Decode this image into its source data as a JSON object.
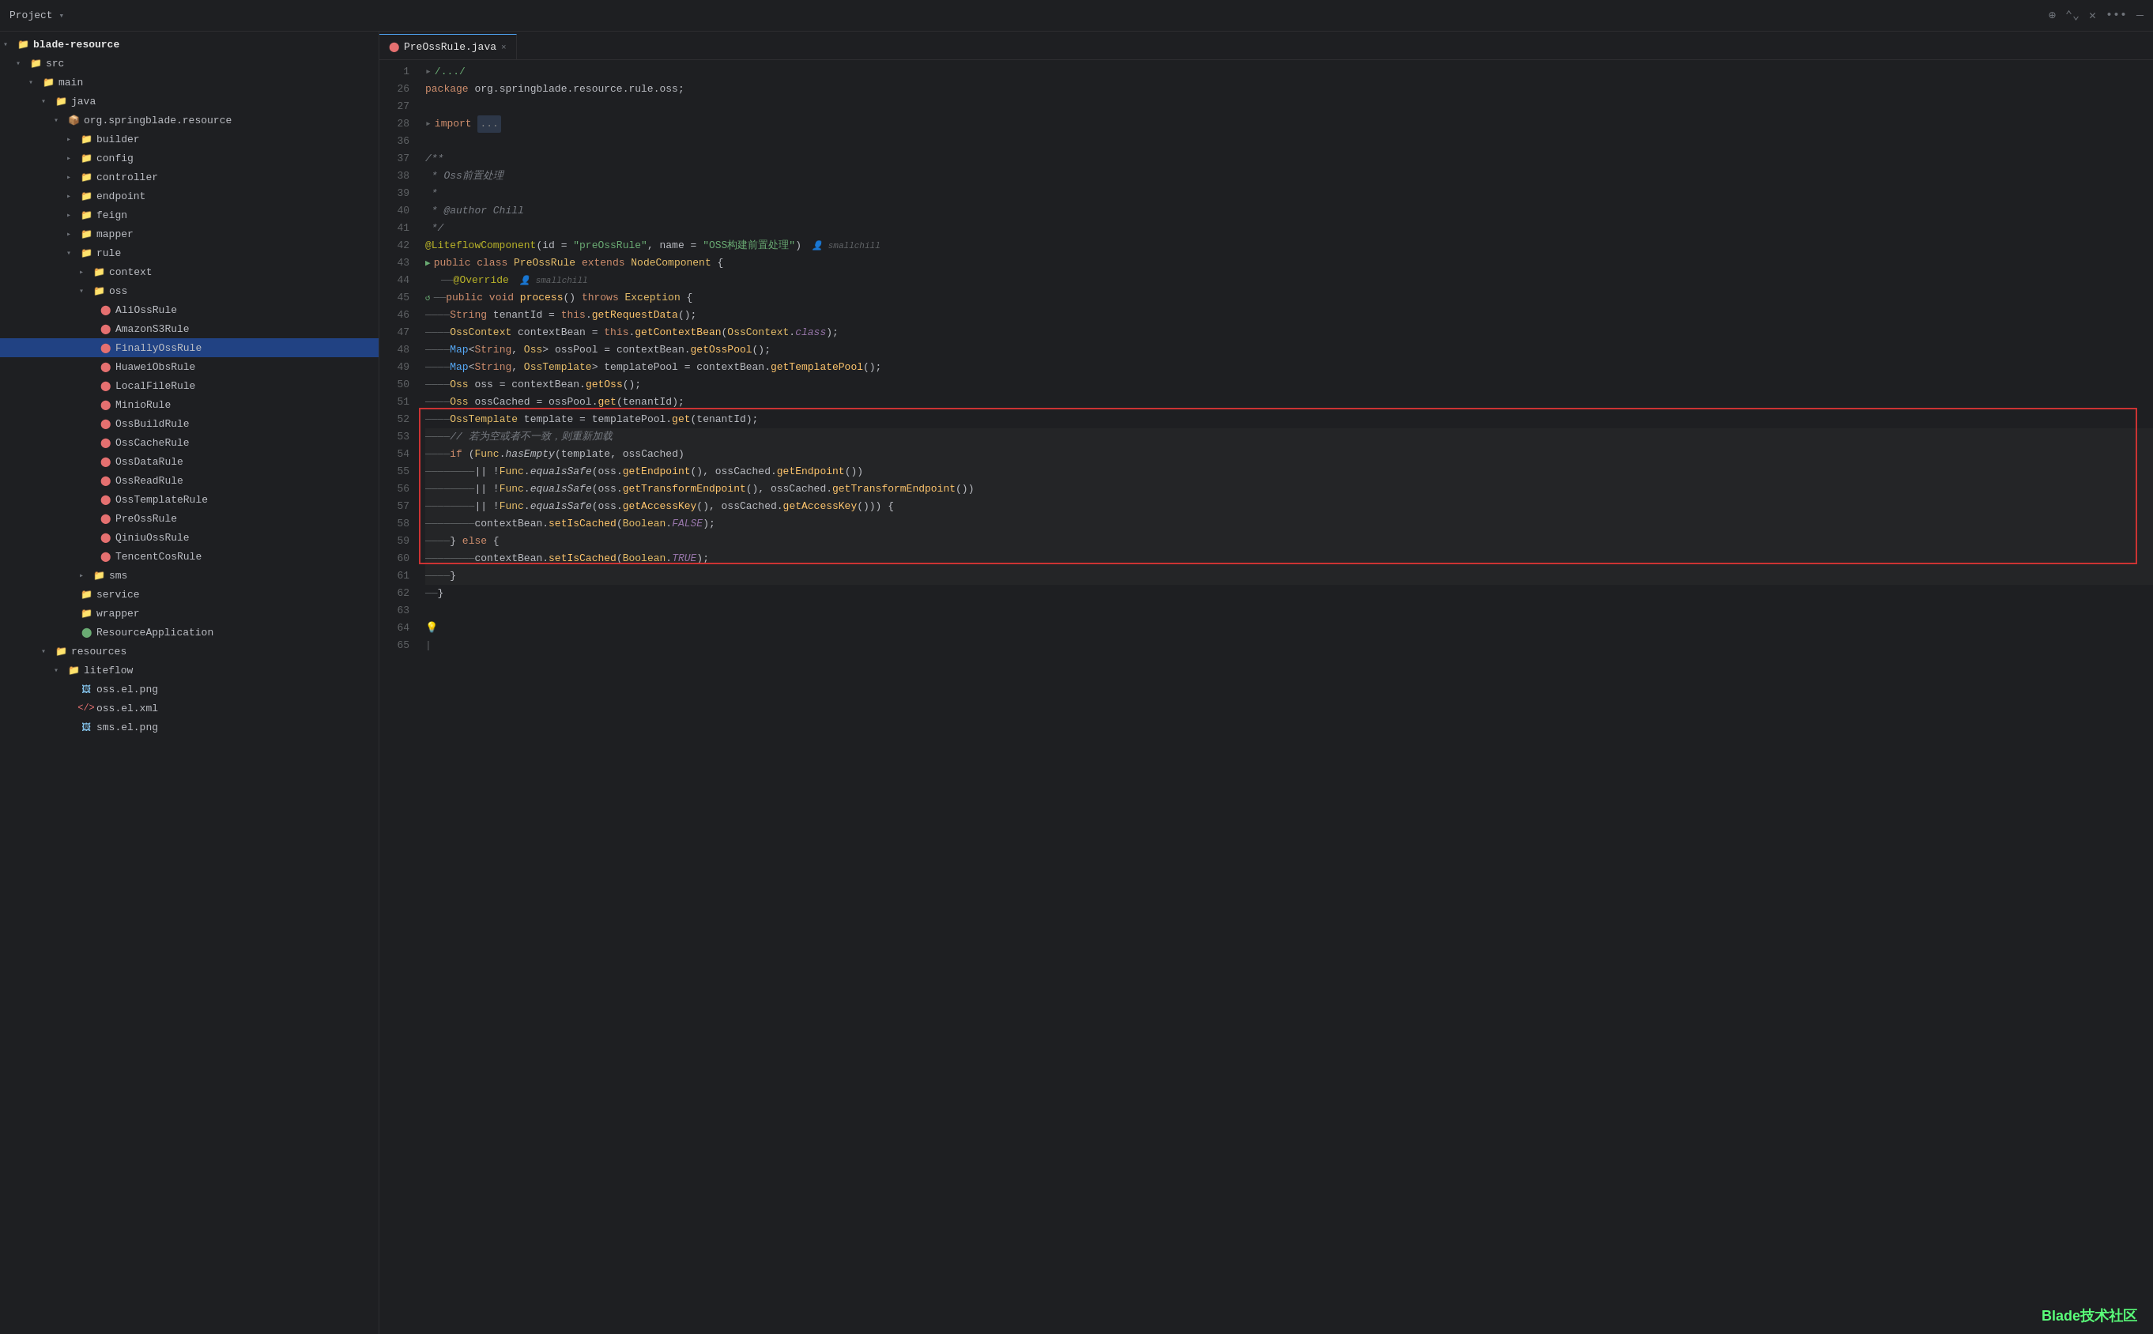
{
  "titleBar": {
    "projectLabel": "Project",
    "icons": [
      "⊕",
      "∧∨",
      "×",
      "•••",
      "—"
    ]
  },
  "tabBar": {
    "tab": {
      "icon": "●",
      "label": "PreOssRule.java",
      "close": "×"
    }
  },
  "sidebar": {
    "items": [
      {
        "id": "blade-resource",
        "label": "blade-resource",
        "indent": 0,
        "arrow": "▾",
        "type": "folder",
        "bold": true
      },
      {
        "id": "src",
        "label": "src",
        "indent": 1,
        "arrow": "▾",
        "type": "folder"
      },
      {
        "id": "main",
        "label": "main",
        "indent": 2,
        "arrow": "▾",
        "type": "folder"
      },
      {
        "id": "java",
        "label": "java",
        "indent": 3,
        "arrow": "▾",
        "type": "folder"
      },
      {
        "id": "org-springblade-resource",
        "label": "org.springblade.resource",
        "indent": 4,
        "arrow": "▾",
        "type": "package"
      },
      {
        "id": "builder",
        "label": "builder",
        "indent": 5,
        "arrow": "▸",
        "type": "folder"
      },
      {
        "id": "config",
        "label": "config",
        "indent": 5,
        "arrow": "▸",
        "type": "folder"
      },
      {
        "id": "controller",
        "label": "controller",
        "indent": 5,
        "arrow": "▸",
        "type": "folder"
      },
      {
        "id": "endpoint",
        "label": "endpoint",
        "indent": 5,
        "arrow": "▸",
        "type": "folder"
      },
      {
        "id": "feign",
        "label": "feign",
        "indent": 5,
        "arrow": "▸",
        "type": "folder"
      },
      {
        "id": "mapper",
        "label": "mapper",
        "indent": 5,
        "arrow": "▸",
        "type": "folder"
      },
      {
        "id": "rule",
        "label": "rule",
        "indent": 5,
        "arrow": "▾",
        "type": "folder"
      },
      {
        "id": "context",
        "label": "context",
        "indent": 6,
        "arrow": "▸",
        "type": "folder"
      },
      {
        "id": "oss",
        "label": "oss",
        "indent": 6,
        "arrow": "▾",
        "type": "folder"
      },
      {
        "id": "AliOssRule",
        "label": "AliOssRule",
        "indent": 7,
        "arrow": "",
        "type": "java"
      },
      {
        "id": "AmazonS3Rule",
        "label": "AmazonS3Rule",
        "indent": 7,
        "arrow": "",
        "type": "java"
      },
      {
        "id": "FinallyOssRule",
        "label": "FinallyOssRule",
        "indent": 7,
        "arrow": "",
        "type": "java",
        "selected": true
      },
      {
        "id": "HuaweiObsRule",
        "label": "HuaweiObsRule",
        "indent": 7,
        "arrow": "",
        "type": "java"
      },
      {
        "id": "LocalFileRule",
        "label": "LocalFileRule",
        "indent": 7,
        "arrow": "",
        "type": "java"
      },
      {
        "id": "MinioRule",
        "label": "MinioRule",
        "indent": 7,
        "arrow": "",
        "type": "java"
      },
      {
        "id": "OssBuildRule",
        "label": "OssBuildRule",
        "indent": 7,
        "arrow": "",
        "type": "java"
      },
      {
        "id": "OssCacheRule",
        "label": "OssCacheRule",
        "indent": 7,
        "arrow": "",
        "type": "java"
      },
      {
        "id": "OssDataRule",
        "label": "OssDataRule",
        "indent": 7,
        "arrow": "",
        "type": "java"
      },
      {
        "id": "OssReadRule",
        "label": "OssReadRule",
        "indent": 7,
        "arrow": "",
        "type": "java"
      },
      {
        "id": "OssTemplateRule",
        "label": "OssTemplateRule",
        "indent": 7,
        "arrow": "",
        "type": "java"
      },
      {
        "id": "PreOssRule",
        "label": "PreOssRule",
        "indent": 7,
        "arrow": "",
        "type": "java"
      },
      {
        "id": "QiniuOssRule",
        "label": "QiniuOssRule",
        "indent": 7,
        "arrow": "",
        "type": "java"
      },
      {
        "id": "TencentCosRule",
        "label": "TencentCosRule",
        "indent": 7,
        "arrow": "",
        "type": "java"
      },
      {
        "id": "sms",
        "label": "sms",
        "indent": 6,
        "arrow": "▸",
        "type": "folder"
      },
      {
        "id": "service",
        "label": "service",
        "indent": 5,
        "arrow": "",
        "type": "folder"
      },
      {
        "id": "wrapper",
        "label": "wrapper",
        "indent": 5,
        "arrow": "",
        "type": "folder"
      },
      {
        "id": "ResourceApplication",
        "label": "ResourceApplication",
        "indent": 5,
        "arrow": "",
        "type": "app"
      },
      {
        "id": "resources",
        "label": "resources",
        "indent": 3,
        "arrow": "▾",
        "type": "folder"
      },
      {
        "id": "liteflow",
        "label": "liteflow",
        "indent": 4,
        "arrow": "▾",
        "type": "folder"
      },
      {
        "id": "oss-el-png",
        "label": "oss.el.png",
        "indent": 5,
        "arrow": "",
        "type": "png"
      },
      {
        "id": "oss-el-xml",
        "label": "oss.el.xml",
        "indent": 5,
        "arrow": "",
        "type": "xml"
      },
      {
        "id": "sms-el-png",
        "label": "sms.el.png",
        "indent": 5,
        "arrow": "",
        "type": "png"
      }
    ]
  },
  "editor": {
    "watermark": "Blade技术社区",
    "lines": [
      {
        "num": "1",
        "content": "folded",
        "gutter": ""
      },
      {
        "num": "26",
        "content": "package_line",
        "gutter": ""
      },
      {
        "num": "27",
        "content": "empty",
        "gutter": ""
      },
      {
        "num": "28",
        "content": "import_line",
        "gutter": ""
      },
      {
        "num": "36",
        "content": "empty",
        "gutter": ""
      },
      {
        "num": "37",
        "content": "javadoc_start",
        "gutter": ""
      },
      {
        "num": "38",
        "content": "javadoc_oss",
        "gutter": ""
      },
      {
        "num": "39",
        "content": "javadoc_star_empty",
        "gutter": ""
      },
      {
        "num": "40",
        "content": "javadoc_author",
        "gutter": ""
      },
      {
        "num": "41",
        "content": "javadoc_end",
        "gutter": ""
      },
      {
        "num": "42",
        "content": "annotation_line",
        "gutter": ""
      },
      {
        "num": "43",
        "content": "class_decl",
        "gutter": "run"
      },
      {
        "num": "44",
        "content": "override_line",
        "gutter": ""
      },
      {
        "num": "45",
        "content": "process_decl",
        "gutter": "run2"
      },
      {
        "num": "46",
        "content": "string_tenantId",
        "gutter": ""
      },
      {
        "num": "47",
        "content": "osscontext_line",
        "gutter": ""
      },
      {
        "num": "48",
        "content": "map_osspool",
        "gutter": ""
      },
      {
        "num": "49",
        "content": "map_templatepool",
        "gutter": ""
      },
      {
        "num": "50",
        "content": "oss_oss",
        "gutter": ""
      },
      {
        "num": "51",
        "content": "oss_cached",
        "gutter": ""
      },
      {
        "num": "52",
        "content": "osstemplate_line",
        "gutter": ""
      },
      {
        "num": "53",
        "content": "comment_reload",
        "gutter": ""
      },
      {
        "num": "54",
        "content": "if_hasempty",
        "gutter": ""
      },
      {
        "num": "55",
        "content": "or_endpoint",
        "gutter": ""
      },
      {
        "num": "56",
        "content": "or_transform",
        "gutter": ""
      },
      {
        "num": "57",
        "content": "or_accesskey",
        "gutter": ""
      },
      {
        "num": "58",
        "content": "setiscached_false",
        "gutter": ""
      },
      {
        "num": "59",
        "content": "else_line",
        "gutter": ""
      },
      {
        "num": "60",
        "content": "setiscached_true",
        "gutter": ""
      },
      {
        "num": "61",
        "content": "close_brace",
        "gutter": ""
      },
      {
        "num": "62",
        "content": "close_brace2",
        "gutter": ""
      },
      {
        "num": "63",
        "content": "empty",
        "gutter": ""
      },
      {
        "num": "64",
        "content": "bulb_line",
        "gutter": ""
      },
      {
        "num": "65",
        "content": "pipe_line",
        "gutter": ""
      }
    ]
  }
}
